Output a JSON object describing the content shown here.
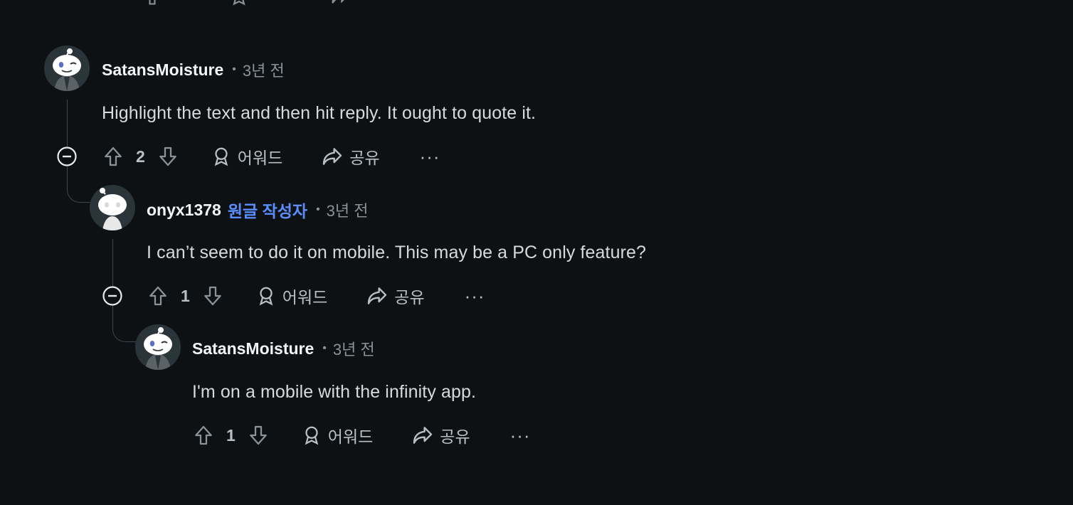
{
  "actions": {
    "award_label": "어워드",
    "share_label": "공유",
    "more_label": "···"
  },
  "comments": [
    {
      "username": "SatansMoisture",
      "op_badge": "",
      "time": "3년 전",
      "text": "Highlight the text and then hit reply. It ought to quote it.",
      "votes": "2"
    },
    {
      "username": "onyx1378",
      "op_badge": "원글 작성자",
      "time": "3년 전",
      "text": "I can’t seem to do it on mobile. This may be a PC only feature?",
      "votes": "1"
    },
    {
      "username": "SatansMoisture",
      "op_badge": "",
      "time": "3년 전",
      "text": "I'm on a mobile with the infinity app.",
      "votes": "1"
    }
  ],
  "colors": {
    "background": "#0e1113",
    "op_badge": "#5a8eff",
    "muted": "#8a9399"
  }
}
